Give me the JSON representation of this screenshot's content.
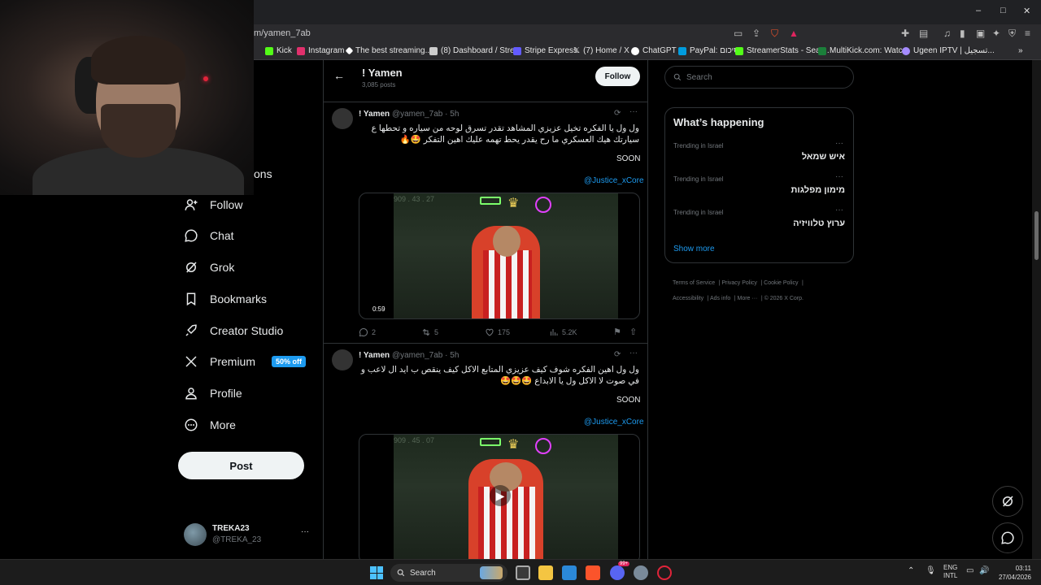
{
  "browser": {
    "url": "m/yamen_7ab",
    "window_controls": {
      "minimize": "–",
      "maximize": "□",
      "close": "✕"
    }
  },
  "bookmarks": [
    {
      "label": "Kick",
      "color": "#53fc18"
    },
    {
      "label": "Instagram",
      "color": "#e1306c"
    },
    {
      "label": "The best streaming...",
      "color": "#ffffff"
    },
    {
      "label": "(8) Dashboard / Stre...",
      "color": "#cccccc"
    },
    {
      "label": "Stripe Express",
      "color": "#635bff"
    },
    {
      "label": "(7) Home / X",
      "color": "#ffffff"
    },
    {
      "label": "ChatGPT",
      "color": "#ffffff"
    },
    {
      "label": "PayPal: סיכום",
      "color": "#009cde"
    },
    {
      "label": "StreamerStats - Sear...",
      "color": "#53fc18"
    },
    {
      "label": "MultiKick.com: Watc...",
      "color": "#1b7f3a"
    },
    {
      "label": "Ugeen IPTV | تسجيل...",
      "color": "#a58bff"
    }
  ],
  "nav": {
    "partial_label": "ons",
    "items": [
      {
        "label": "Follow",
        "icon": "add-user-icon"
      },
      {
        "label": "Chat",
        "icon": "chat-icon"
      },
      {
        "label": "Grok",
        "icon": "grok-icon"
      },
      {
        "label": "Bookmarks",
        "icon": "bookmark-icon"
      },
      {
        "label": "Creator Studio",
        "icon": "rocket-icon"
      },
      {
        "label": "Premium",
        "icon": "x-logo-icon",
        "badge": "50% off"
      },
      {
        "label": "Profile",
        "icon": "person-icon"
      },
      {
        "label": "More",
        "icon": "more-circle-icon"
      }
    ],
    "post_label": "Post"
  },
  "account": {
    "display_name": "TREKA23",
    "handle": "@TREKA_23",
    "menu": "···"
  },
  "profile_header": {
    "name": "! Yamen",
    "posts": "3,085 posts",
    "follow_label": "Follow"
  },
  "tweets": [
    {
      "name": "! Yamen",
      "handle": "@yamen_7ab",
      "time": "· 5h",
      "text": "ول ول يا الفكره تخيل عزيزي المشاهد تقدر تسرق لوحه من سياره و تحطها ع سيارتك هيك العسكري ما رح يقدر يحط تهمه عليك اهين التفكر 🤩🔥",
      "soon": "SOON",
      "mention": "@Justice_xCore",
      "duration": "0:59",
      "overlay_text": "909 . 43 . 27",
      "replies": "2",
      "reposts": "5",
      "likes": "175",
      "views": "5.2K"
    },
    {
      "name": "! Yamen",
      "handle": "@yamen_7ab",
      "time": "· 5h",
      "text": "ول ول اهين الفكره شوف كيف عزيزي المتابع الاكل كيف ينقص ب ايد ال لاعب و في صوت لا الاكل ول يا الابداع 🤩🤩🤩",
      "soon": "SOON",
      "mention": "@Justice_xCore",
      "overlay_text": "909 . 45 . 07"
    }
  ],
  "right": {
    "search_placeholder": "Search",
    "happening_title": "What’s happening",
    "trends": [
      {
        "category": "Trending in Israel",
        "name": "איש שמאל"
      },
      {
        "category": "Trending in Israel",
        "name": "מימון מפלגות"
      },
      {
        "category": "Trending in Israel",
        "name": "ערוץ טלוויזיה"
      }
    ],
    "show_more": "Show more",
    "footer": [
      "Terms of Service",
      "Privacy Policy",
      "Cookie Policy",
      "Accessibility",
      "Ads info",
      "More ···",
      "© 2026 X Corp."
    ]
  },
  "taskbar": {
    "search_label": "Search",
    "lang_line1": "ENG",
    "lang_line2": "INTL",
    "time": "03:11",
    "date": "27/04/2026",
    "notification_count": "99+"
  }
}
